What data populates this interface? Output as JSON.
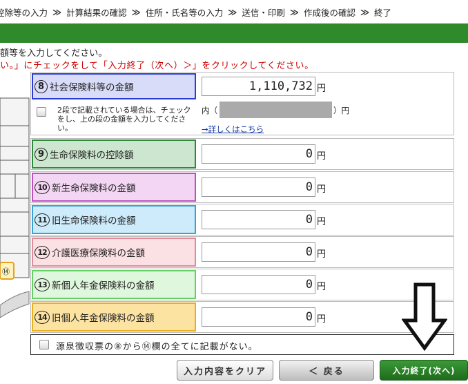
{
  "steps": [
    "控除等の入力",
    "計算結果の確認",
    "住所・氏名等の入力",
    "送信・印刷",
    "作成後の確認",
    "終了"
  ],
  "step_separator": "≫",
  "instructions": {
    "line1": "額等を入力してください。",
    "line2": "い。」にチェックをして「入力終了（次へ）＞」をクリックしてください。"
  },
  "rows": [
    {
      "num": "8",
      "label": "社会保険料等の金額",
      "value": "1,110,732",
      "unit": "円",
      "border": "#2b3bd6",
      "bg": "#d9dcf9"
    },
    {
      "num": "9",
      "label": "生命保険料の控除額",
      "value": "0",
      "unit": "円",
      "border": "#2d8a3a",
      "bg": "#cde6cf"
    },
    {
      "num": "10",
      "label": "新生命保険料の金額",
      "value": "0",
      "unit": "円",
      "border": "#c050c0",
      "bg": "#f3d6f3"
    },
    {
      "num": "11",
      "label": "旧生命保険料の金額",
      "value": "0",
      "unit": "円",
      "border": "#3aa0d8",
      "bg": "#cdebfa"
    },
    {
      "num": "12",
      "label": "介護医療保険料の金額",
      "value": "0",
      "unit": "円",
      "border": "#e08a9a",
      "bg": "#fbe0e4"
    },
    {
      "num": "13",
      "label": "新個人年金保険料の金額",
      "value": "0",
      "unit": "円",
      "border": "#66d066",
      "bg": "#dff7dc"
    },
    {
      "num": "14",
      "label": "旧個人年金保険料の金額",
      "value": "0",
      "unit": "円",
      "border": "#e8b020",
      "bg": "#fde3a2"
    }
  ],
  "note": {
    "text": "2段で記載されている場合は、チェックをし、上の段の金額を入力してください。",
    "uchi": "内（",
    "uchi_close": "）円",
    "link": "→詳しくはこちら"
  },
  "bottom_check": "源泉徴収票の⑧から⑭欄の全てに記載がない。",
  "buttons": {
    "clear": "入力内容をクリア",
    "back": "＜ 戻る",
    "next": "入力終了(次へ)"
  }
}
